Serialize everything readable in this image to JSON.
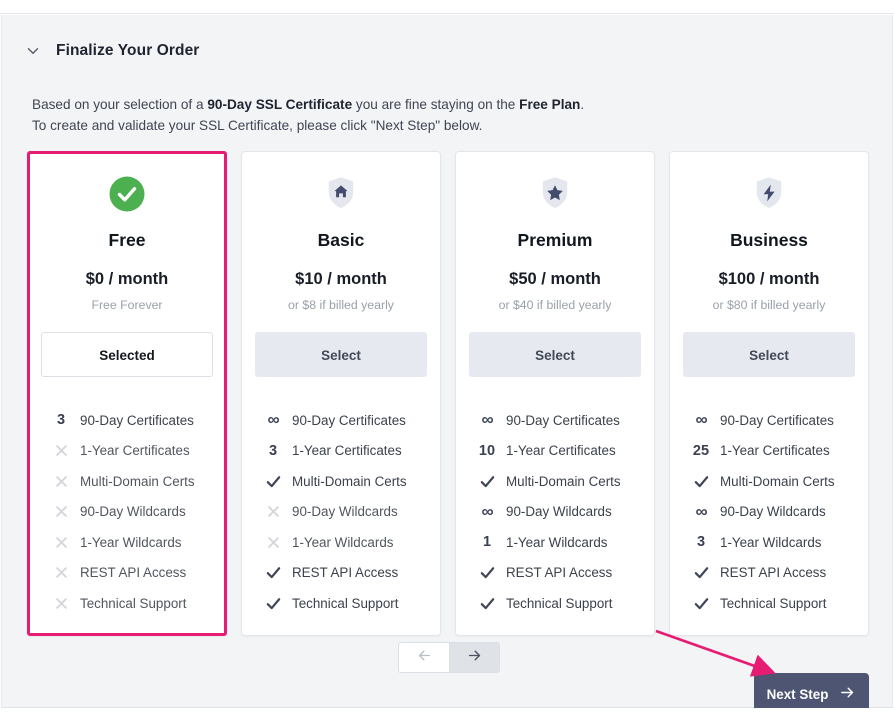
{
  "section": {
    "title": "Finalize Your Order",
    "collapse_icon": "chevron-down-icon"
  },
  "intro": {
    "line1_a": "Based on your selection of a ",
    "line1_b": "90-Day SSL Certificate",
    "line1_c": " you are fine staying on the ",
    "line1_d": "Free Plan",
    "line1_e": ".",
    "line2": "To create and validate your SSL Certificate, please click \"Next Step\" below."
  },
  "feature_labels": [
    "90-Day Certificates",
    "1-Year Certificates",
    "Multi-Domain Certs",
    "90-Day Wildcards",
    "1-Year Wildcards",
    "REST API Access",
    "Technical Support"
  ],
  "plans": [
    {
      "id": "free",
      "icon": "green-check-circle-icon",
      "name": "Free",
      "price": "$0 / month",
      "sub": "Free Forever",
      "button_label": "Selected",
      "selected": true,
      "marks": [
        "3",
        "cross",
        "cross",
        "cross",
        "cross",
        "cross",
        "cross"
      ]
    },
    {
      "id": "basic",
      "icon": "shield-home-icon",
      "name": "Basic",
      "price": "$10 / month",
      "sub": "or $8 if billed yearly",
      "button_label": "Select",
      "selected": false,
      "marks": [
        "infinity",
        "3",
        "check",
        "cross",
        "cross",
        "check",
        "check"
      ]
    },
    {
      "id": "premium",
      "icon": "shield-star-icon",
      "name": "Premium",
      "price": "$50 / month",
      "sub": "or $40 if billed yearly",
      "button_label": "Select",
      "selected": false,
      "marks": [
        "infinity",
        "10",
        "check",
        "infinity",
        "1",
        "check",
        "check"
      ]
    },
    {
      "id": "business",
      "icon": "shield-bolt-icon",
      "name": "Business",
      "price": "$100 / month",
      "sub": "or $80 if billed yearly",
      "button_label": "Select",
      "selected": false,
      "marks": [
        "infinity",
        "25",
        "check",
        "infinity",
        "3",
        "check",
        "check"
      ]
    }
  ],
  "pager": {
    "prev_icon": "arrow-left-icon",
    "next_icon": "arrow-right-icon"
  },
  "next_step": {
    "label": "Next Step",
    "icon": "arrow-right-icon"
  },
  "colors": {
    "selected_border": "#e61b72",
    "annotation_arrow": "#e61b72",
    "next_step_bg": "#4e5573",
    "check_green": "#4caf50",
    "panel_bg": "#f3f4f6",
    "mark_check": "#3e4658",
    "mark_cross": "#d3d6dc"
  }
}
